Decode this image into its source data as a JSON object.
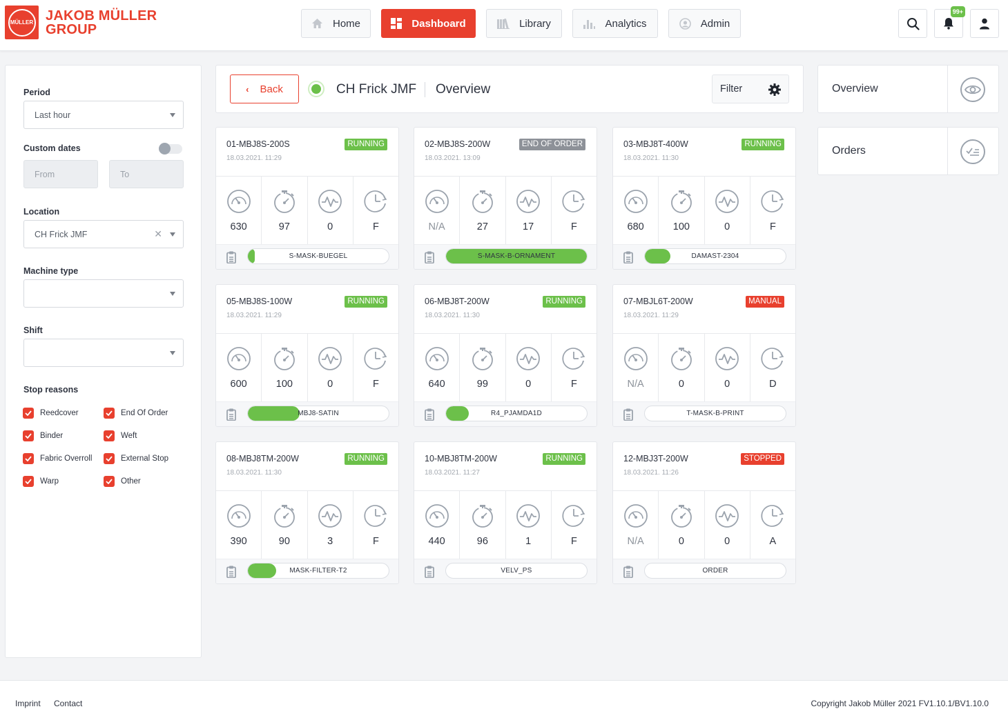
{
  "brand": {
    "line1": "JAKOB MÜLLER",
    "line2": "GROUP",
    "mark": "MÜLLER",
    "color": "#e8402e"
  },
  "nav": [
    {
      "label": "Home",
      "icon": "home-icon",
      "active": false
    },
    {
      "label": "Dashboard",
      "icon": "dashboard-icon",
      "active": true
    },
    {
      "label": "Library",
      "icon": "library-icon",
      "active": false
    },
    {
      "label": "Analytics",
      "icon": "analytics-icon",
      "active": false
    },
    {
      "label": "Admin",
      "icon": "admin-icon",
      "active": false
    }
  ],
  "header_icons": {
    "search": "search-icon",
    "notifications": "bell-icon",
    "notifications_badge": "99+",
    "profile": "user-icon"
  },
  "sidebar": {
    "period_label": "Period",
    "period_value": "Last hour",
    "custom_dates_label": "Custom dates",
    "from_placeholder": "From",
    "to_placeholder": "To",
    "location_label": "Location",
    "location_value": "CH Frick JMF",
    "machine_type_label": "Machine type",
    "machine_type_value": "",
    "shift_label": "Shift",
    "shift_value": "",
    "stop_reasons_label": "Stop reasons",
    "stop_reasons": [
      {
        "label": "Reedcover",
        "checked": true
      },
      {
        "label": "End Of Order",
        "checked": true
      },
      {
        "label": "Binder",
        "checked": true
      },
      {
        "label": "Weft",
        "checked": true
      },
      {
        "label": "Fabric Overroll",
        "checked": true
      },
      {
        "label": "External Stop",
        "checked": true
      },
      {
        "label": "Warp",
        "checked": true
      },
      {
        "label": "Other",
        "checked": true
      }
    ]
  },
  "topbar": {
    "back_label": "Back",
    "location": "CH Frick JMF",
    "view": "Overview",
    "filter_label": "Filter"
  },
  "right_panels": [
    {
      "label": "Overview",
      "icon": "eye-icon"
    },
    {
      "label": "Orders",
      "icon": "checklist-icon"
    }
  ],
  "status_colors": {
    "RUNNING": "#6cc04a",
    "END OF ORDER": "#8d9198",
    "MANUAL": "#e8402e",
    "STOPPED": "#e8402e"
  },
  "machines": [
    {
      "name": "01-MBJ8S-200S",
      "time": "18.03.2021. 11:29",
      "status": "RUNNING",
      "speed": "630",
      "efficiency": "97",
      "stops": "0",
      "shift": "F",
      "order": "S-MASK-BUEGEL",
      "progress": 4
    },
    {
      "name": "02-MBJ8S-200W",
      "time": "18.03.2021. 13:09",
      "status": "END OF ORDER",
      "speed": "N/A",
      "efficiency": "27",
      "stops": "17",
      "shift": "F",
      "order": "S-MASK-B-ORNAMENT",
      "progress": 100
    },
    {
      "name": "03-MBJ8T-400W",
      "time": "18.03.2021. 11:30",
      "status": "RUNNING",
      "speed": "680",
      "efficiency": "100",
      "stops": "0",
      "shift": "F",
      "order": "DAMAST-2304",
      "progress": 18
    },
    {
      "name": "05-MBJ8S-100W",
      "time": "18.03.2021. 11:29",
      "status": "RUNNING",
      "speed": "600",
      "efficiency": "100",
      "stops": "0",
      "shift": "F",
      "order": "MBJ8-SATIN",
      "progress": 37
    },
    {
      "name": "06-MBJ8T-200W",
      "time": "18.03.2021. 11:30",
      "status": "RUNNING",
      "speed": "640",
      "efficiency": "99",
      "stops": "0",
      "shift": "F",
      "order": "R4_PJAMDA1D",
      "progress": 16
    },
    {
      "name": "07-MBJL6T-200W",
      "time": "18.03.2021. 11:29",
      "status": "MANUAL",
      "speed": "N/A",
      "efficiency": "0",
      "stops": "0",
      "shift": "D",
      "order": "T-MASK-B-PRINT",
      "progress": 0
    },
    {
      "name": "08-MBJ8TM-200W",
      "time": "18.03.2021. 11:30",
      "status": "RUNNING",
      "speed": "390",
      "efficiency": "90",
      "stops": "3",
      "shift": "F",
      "order": "MASK-FILTER-T2",
      "progress": 20
    },
    {
      "name": "10-MBJ8TM-200W",
      "time": "18.03.2021. 11:27",
      "status": "RUNNING",
      "speed": "440",
      "efficiency": "96",
      "stops": "1",
      "shift": "F",
      "order": "VELV_PS",
      "progress": 0
    },
    {
      "name": "12-MBJ3T-200W",
      "time": "18.03.2021. 11:26",
      "status": "STOPPED",
      "speed": "N/A",
      "efficiency": "0",
      "stops": "0",
      "shift": "A",
      "order": "ORDER",
      "progress": 0
    }
  ],
  "metric_icons": [
    "speedometer-icon",
    "stopwatch-icon",
    "pulse-icon",
    "clock-icon"
  ],
  "footer": {
    "imprint": "Imprint",
    "contact": "Contact",
    "copyright": "Copyright Jakob Müller 2021 FV1.10.1/BV1.10.0"
  }
}
